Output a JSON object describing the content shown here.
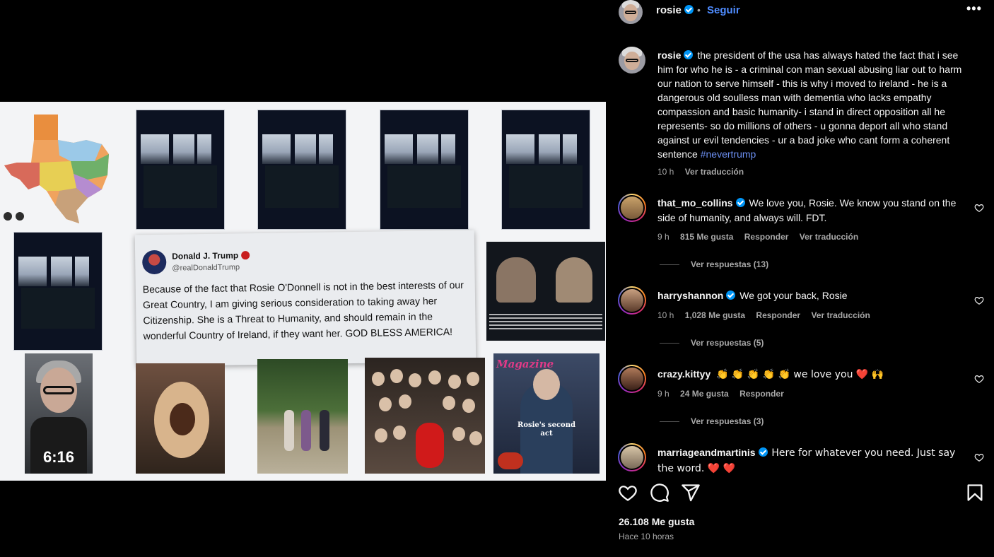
{
  "post": {
    "author": "rosie",
    "follow_label": "Seguir",
    "dot": "•",
    "more_label": "•••",
    "caption": "the president of the usa has always hated the fact that i see him for who he is - a criminal con man sexual abusing liar out to harm our nation to serve himself - this is why i moved to ireland - he is a dangerous old soulless man with dementia who lacks empathy compassion and basic humanity- i stand in direct opposition all he represents- so do millions of others - u gonna deport all who stand against ur evil tendencies - ur a bad joke who cant form a coherent sentence",
    "hashtag": "#nevertrump",
    "time": "10 h",
    "translate_label": "Ver traducción",
    "likes_label": "26.108 Me gusta",
    "posted_ago": "Hace 10 horas"
  },
  "media": {
    "tweet_name": "Donald J. Trump",
    "tweet_handle": "@realDonaldTrump",
    "tweet_text": "Because of the fact that Rosie O'Donnell is not in the best interests of our Great Country, I am giving serious consideration to taking away her Citizenship. She is a Threat to Humanity, and should remain in the wonderful Country of Ireland, if they want her. GOD BLESS AMERICA!",
    "video_time": "6:16",
    "magazine_title": "Magazine",
    "magazine_subtitle": "Rosie's second act"
  },
  "comments": [
    {
      "user": "that_mo_collins",
      "text": "We love you, Rosie. We know you stand on the side of humanity, and always will. FDT.",
      "time": "9 h",
      "likes": "815 Me gusta",
      "reply": "Responder",
      "translate": "Ver traducción",
      "replies": "Ver respuestas (13)"
    },
    {
      "user": "harryshannon",
      "text": "We got your back, Rosie",
      "time": "10 h",
      "likes": "1,028 Me gusta",
      "reply": "Responder",
      "translate": "Ver traducción",
      "replies": "Ver respuestas (5)"
    },
    {
      "user": "crazy.kittyy",
      "text": "👏 👏 👏 👏 👏 we love you ❤️ 🙌",
      "time": "9 h",
      "likes": "24 Me gusta",
      "reply": "Responder",
      "replies": "Ver respuestas (3)"
    },
    {
      "user": "marriageandmartinis",
      "text": "Here for whatever you need. Just say the word. ❤️ ❤️"
    }
  ],
  "icons": {
    "like": "heart-icon",
    "comment": "comment-icon",
    "share": "share-icon",
    "save": "bookmark-icon",
    "verified": "verified-badge-icon"
  },
  "colors": {
    "link": "#4f8cff",
    "verified": "#0095f6",
    "hashtag": "#6b8ef0",
    "meta": "#a8a8a8"
  }
}
